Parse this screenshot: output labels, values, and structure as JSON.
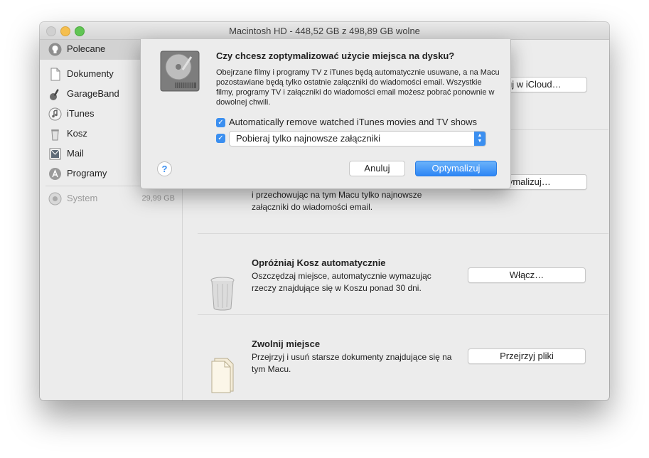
{
  "window": {
    "title": "Macintosh HD - 448,52 GB z 498,89 GB wolne"
  },
  "sidebar": {
    "items": [
      {
        "label": "Polecane",
        "icon": "lightbulb-icon",
        "selected": true
      },
      {
        "label": "Dokumenty",
        "icon": "document-icon"
      },
      {
        "label": "GarageBand",
        "icon": "guitar-icon"
      },
      {
        "label": "iTunes",
        "icon": "music-note-icon"
      },
      {
        "label": "Kosz",
        "icon": "trash-icon"
      },
      {
        "label": "Mail",
        "icon": "mail-icon"
      },
      {
        "label": "Programy",
        "icon": "app-store-icon"
      }
    ],
    "system": {
      "label": "System",
      "size": "29,99 GB",
      "icon": "gear-icon"
    }
  },
  "main": {
    "icloud_button": "owuj w iCloud…",
    "optimize_section": {
      "button": "tymalizuj…",
      "desc": "i przechowując na tym Macu tylko najnowsze załączniki do wiadomości email."
    },
    "trash_section": {
      "title": "Opróżniaj Kosz automatycznie",
      "desc": "Oszczędzaj miejsce, automatycznie wymazując rzeczy znajdujące się w Koszu ponad 30 dni.",
      "button": "Włącz…"
    },
    "clean_section": {
      "title": "Zwolnij miejsce",
      "desc": "Przejrzyj i usuń starsze dokumenty znajdujące się na tym Macu.",
      "button": "Przejrzyj pliki"
    }
  },
  "dialog": {
    "icon": "hard-drive-icon",
    "title": "Czy chcesz zoptymalizować użycie miejsca na dysku?",
    "body": "Obejrzane filmy i programy TV z iTunes będą automatycznie usuwane, a na Macu pozostawiane będą tylko ostatnie załączniki do wiadomości email. Wszystkie filmy, programy TV i załączniki do wiadomości email możesz pobrać ponownie w dowolnej chwili.",
    "checkbox1": {
      "label": "Automatically remove watched iTunes movies and TV shows",
      "checked": true
    },
    "checkbox2": {
      "checked": true,
      "select_value": "Pobieraj tylko najnowsze załączniki"
    },
    "help": "?",
    "cancel_label": "Anuluj",
    "ok_label": "Optymalizuj"
  },
  "colors": {
    "accent": "#3b8ff0"
  }
}
